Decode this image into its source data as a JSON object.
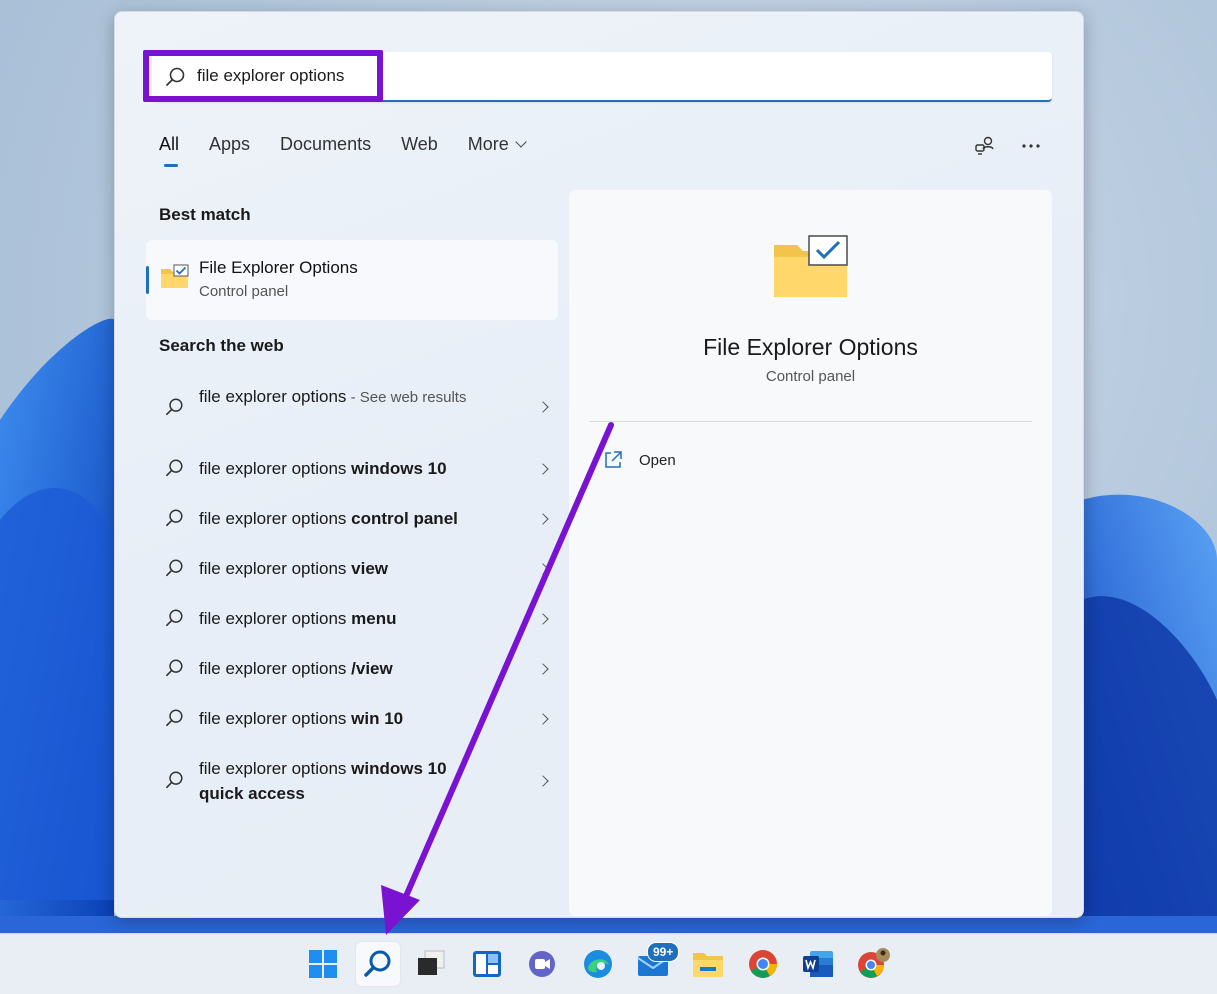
{
  "search": {
    "value": "file explorer options",
    "placeholder": ""
  },
  "tabs": [
    {
      "label": "All",
      "active": true
    },
    {
      "label": "Apps"
    },
    {
      "label": "Documents"
    },
    {
      "label": "Web"
    },
    {
      "label": "More"
    }
  ],
  "toolbar": {
    "accounts_icon": "person-connect-icon",
    "more_icon": "ellipsis-icon"
  },
  "best_match": {
    "section_title": "Best match",
    "title": "File Explorer Options",
    "subtitle": "Control panel"
  },
  "web": {
    "section_title": "Search the web",
    "items": [
      {
        "prefix": "file explorer options",
        "bold": "",
        "note": " - See web results"
      },
      {
        "prefix": "file explorer options ",
        "bold": "windows 10",
        "note": ""
      },
      {
        "prefix": "file explorer options ",
        "bold": "control panel",
        "note": ""
      },
      {
        "prefix": "file explorer options ",
        "bold": "view",
        "note": ""
      },
      {
        "prefix": "file explorer options ",
        "bold": "menu",
        "note": ""
      },
      {
        "prefix": "file explorer options ",
        "bold": "/view",
        "note": ""
      },
      {
        "prefix": "file explorer options ",
        "bold": "win 10",
        "note": ""
      },
      {
        "prefix": "file explorer options ",
        "bold": "windows 10 quick access",
        "note": ""
      }
    ]
  },
  "detail": {
    "title": "File Explorer Options",
    "subtitle": "Control panel",
    "open_label": "Open"
  },
  "taskbar": {
    "items": [
      "windows-start-icon",
      "search-icon",
      "task-view-icon",
      "widgets-icon",
      "teams-chat-icon",
      "edge-icon",
      "mail-icon",
      "file-explorer-icon",
      "chrome-icon",
      "word-icon",
      "chrome-profile-icon"
    ],
    "mail_badge": "99+"
  },
  "colors": {
    "accent": "#1f6fbf",
    "highlight": "#7a12d1"
  }
}
